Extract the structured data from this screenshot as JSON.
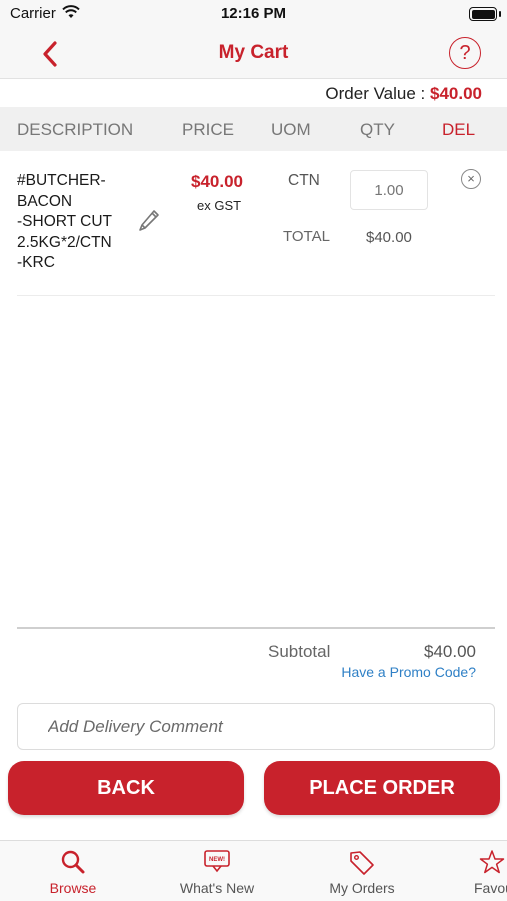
{
  "status_bar": {
    "carrier": "Carrier",
    "time": "12:16 PM"
  },
  "header": {
    "title": "My Cart"
  },
  "order_value": {
    "label": "Order Value :",
    "amount": "$40.00"
  },
  "columns": {
    "description": "DESCRIPTION",
    "price": "PRICE",
    "uom": "UOM",
    "qty": "QTY",
    "del": "DEL"
  },
  "cart_items": [
    {
      "description_lines": [
        "#BUTCHER-",
        "BACON",
        "-SHORT CUT",
        "2.5KG*2/CTN",
        "-KRC"
      ],
      "price": "$40.00",
      "tax_note": "ex GST",
      "uom": "CTN",
      "qty_placeholder": "1.00",
      "total_label": "TOTAL",
      "total": "$40.00"
    }
  ],
  "summary": {
    "subtotal_label": "Subtotal",
    "subtotal": "$40.00",
    "promo_link": "Have a Promo Code?"
  },
  "comment": {
    "placeholder": "Add Delivery Comment"
  },
  "buttons": {
    "back": "BACK",
    "place_order": "PLACE ORDER"
  },
  "tabbar": {
    "items": [
      {
        "label": "Browse",
        "icon": "search-icon"
      },
      {
        "label": "What's New",
        "icon": "new-badge-icon"
      },
      {
        "label": "My Orders",
        "icon": "tag-icon"
      },
      {
        "label": "Favou",
        "icon": "star-icon"
      }
    ]
  },
  "colors": {
    "accent": "#c8222c",
    "link": "#2f80c6"
  }
}
